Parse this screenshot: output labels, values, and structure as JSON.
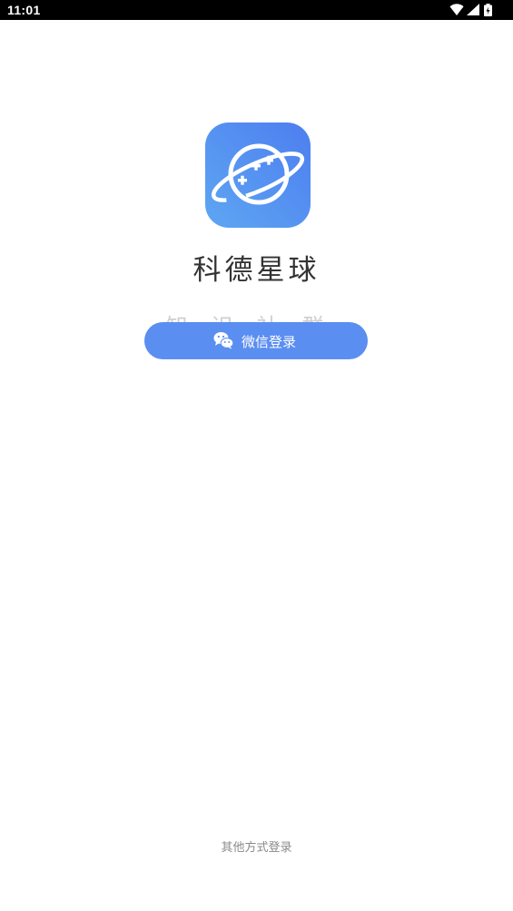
{
  "status_bar": {
    "time": "11:01",
    "icons": [
      "wifi-icon",
      "signal-icon",
      "battery-icon"
    ]
  },
  "app": {
    "logo_icon": "planet-gamepad-logo-icon",
    "name": "科德星球",
    "tagline": "知识社群"
  },
  "login": {
    "wechat_button_label": "微信登录",
    "wechat_icon": "wechat-icon",
    "other_methods_label": "其他方式登录"
  },
  "colors": {
    "status_bar_bg": "#000000",
    "accent": "#5b8ef1",
    "app_name_text": "#333333",
    "secondary_text": "#8a8a8a",
    "background": "#ffffff"
  }
}
